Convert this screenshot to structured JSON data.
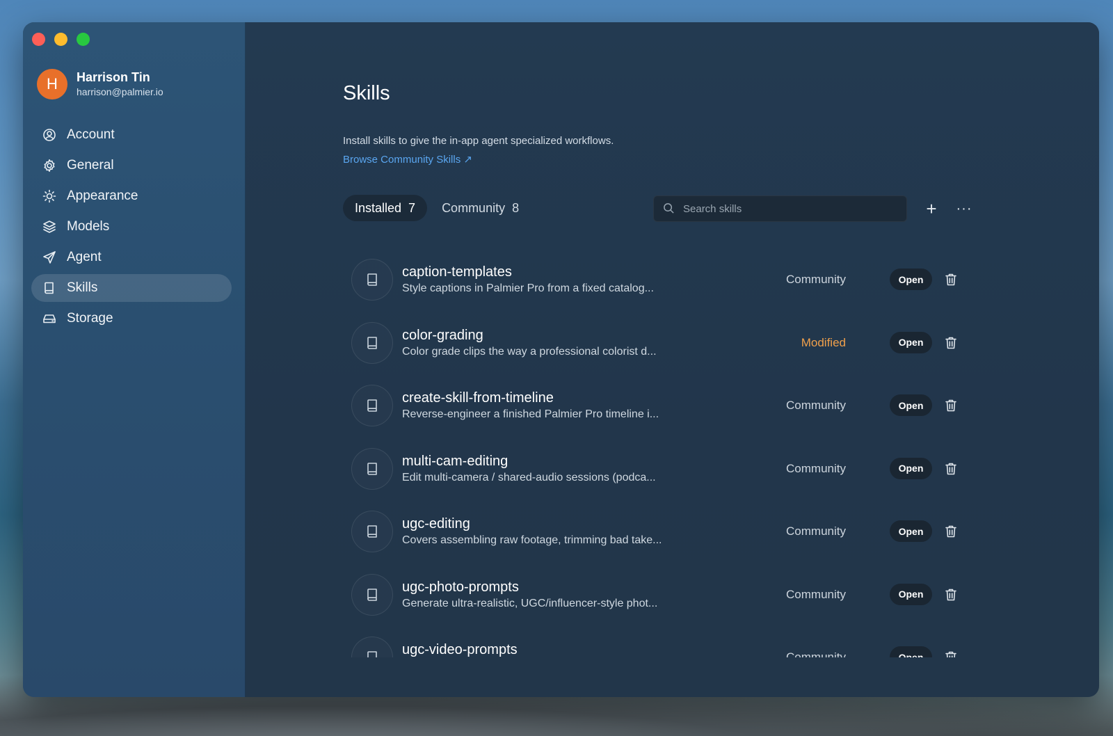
{
  "user": {
    "initial": "H",
    "name": "Harrison Tin",
    "email": "harrison@palmier.io"
  },
  "sidebar": {
    "items": [
      {
        "label": "Account",
        "icon": "account-icon"
      },
      {
        "label": "General",
        "icon": "gear-icon"
      },
      {
        "label": "Appearance",
        "icon": "sun-icon"
      },
      {
        "label": "Models",
        "icon": "layers-icon"
      },
      {
        "label": "Agent",
        "icon": "send-icon"
      },
      {
        "label": "Skills",
        "icon": "book-icon",
        "active": true
      },
      {
        "label": "Storage",
        "icon": "drive-icon"
      }
    ]
  },
  "main": {
    "title": "Skills",
    "description": "Install skills to give the in-app agent specialized workflows.",
    "browse_link": "Browse Community Skills ↗",
    "tabs": [
      {
        "label": "Installed",
        "count": "7",
        "active": true
      },
      {
        "label": "Community",
        "count": "8",
        "active": false
      }
    ],
    "search": {
      "placeholder": "Search skills",
      "value": ""
    },
    "add_label": "+",
    "more_label": "···"
  },
  "skills": [
    {
      "name": "caption-templates",
      "description": "Style captions in Palmier Pro from a fixed catalog...",
      "source": "Community",
      "modified": false,
      "open_label": "Open"
    },
    {
      "name": "color-grading",
      "description": "Color grade clips the way a professional colorist d...",
      "source": "Modified",
      "modified": true,
      "open_label": "Open"
    },
    {
      "name": "create-skill-from-timeline",
      "description": "Reverse-engineer a finished Palmier Pro timeline i...",
      "source": "Community",
      "modified": false,
      "open_label": "Open"
    },
    {
      "name": "multi-cam-editing",
      "description": "Edit multi-camera / shared-audio sessions (podca...",
      "source": "Community",
      "modified": false,
      "open_label": "Open"
    },
    {
      "name": "ugc-editing",
      "description": "Covers assembling raw footage, trimming bad take...",
      "source": "Community",
      "modified": false,
      "open_label": "Open"
    },
    {
      "name": "ugc-photo-prompts",
      "description": "Generate ultra-realistic, UGC/influencer-style phot...",
      "source": "Community",
      "modified": false,
      "open_label": "Open"
    },
    {
      "name": "ugc-video-prompts",
      "description": "",
      "source": "Community",
      "modified": false,
      "open_label": "Open"
    }
  ],
  "colors": {
    "accent_link": "#5aa6f0",
    "modified": "#f0a04b",
    "avatar": "#e8702a"
  }
}
